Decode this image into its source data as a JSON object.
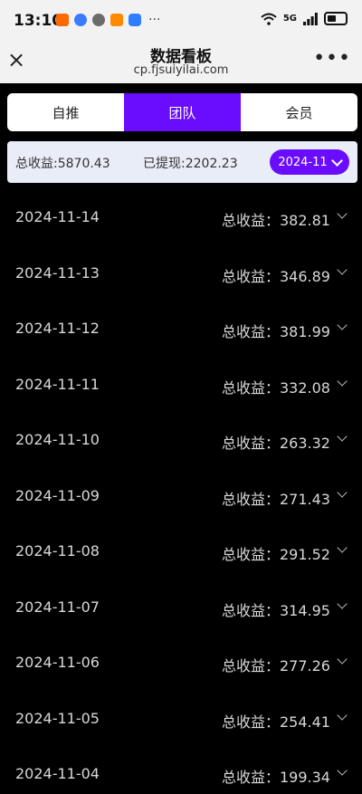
{
  "status": {
    "time": "13:10",
    "network": "5G"
  },
  "nav": {
    "title": "数据看板",
    "subtitle": "cp.fjsuiyilai.com",
    "close": "×",
    "more": "•••"
  },
  "tabs": [
    {
      "label": "自推",
      "active": false
    },
    {
      "label": "团队",
      "active": true
    },
    {
      "label": "会员",
      "active": false
    }
  ],
  "summary": {
    "total": "总收益:5870.43",
    "withdrawn": "已提现:2202.23",
    "month": "2024-11"
  },
  "rows": [
    {
      "date": "2024-11-14",
      "amount": "总收益：382.81"
    },
    {
      "date": "2024-11-13",
      "amount": "总收益：346.89"
    },
    {
      "date": "2024-11-12",
      "amount": "总收益：381.99"
    },
    {
      "date": "2024-11-11",
      "amount": "总收益：332.08"
    },
    {
      "date": "2024-11-10",
      "amount": "总收益：263.32"
    },
    {
      "date": "2024-11-09",
      "amount": "总收益：271.43"
    },
    {
      "date": "2024-11-08",
      "amount": "总收益：291.52"
    },
    {
      "date": "2024-11-07",
      "amount": "总收益：314.95"
    },
    {
      "date": "2024-11-06",
      "amount": "总收益：277.26"
    },
    {
      "date": "2024-11-05",
      "amount": "总收益：254.41"
    },
    {
      "date": "2024-11-04",
      "amount": "总收益：199.34"
    }
  ],
  "colors": {
    "accent": "#6a0dff",
    "summary_bg": "#e9edf8",
    "page_bg": "#000000"
  }
}
